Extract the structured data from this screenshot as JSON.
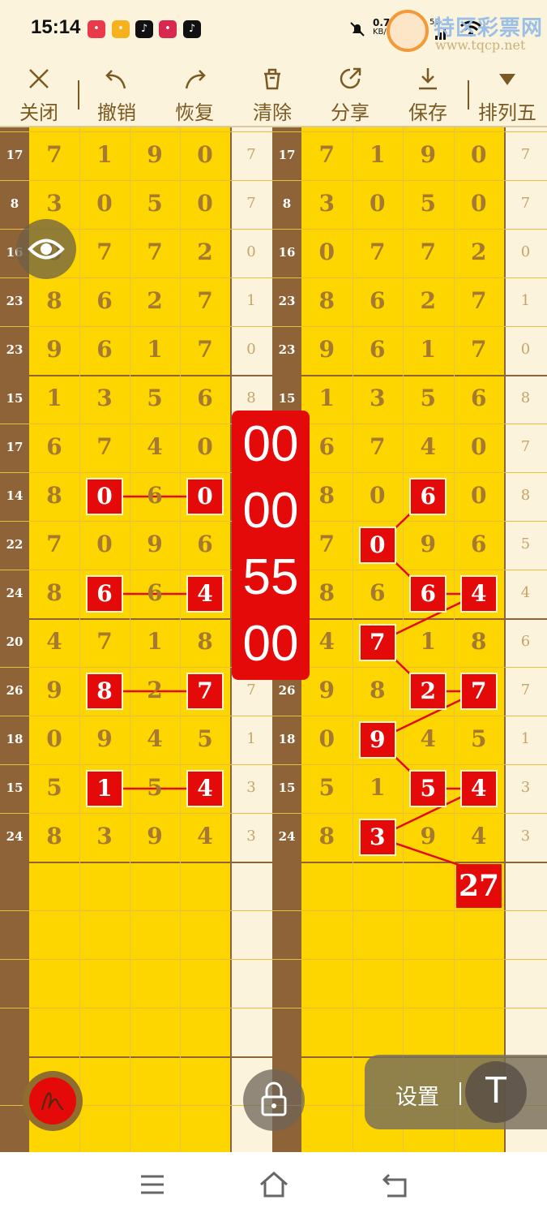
{
  "status": {
    "time": "15:14",
    "net_speed": "0.70 KB/s",
    "net_top": "0.70",
    "net_unit": "KB/s",
    "sig1": "5G",
    "sig2": "5G",
    "apps": [
      {
        "icon": "app-icon-1",
        "color": "#e83a4b"
      },
      {
        "icon": "app-icon-2",
        "color": "#f5b21c"
      },
      {
        "icon": "tiktok-icon",
        "color": "#111111"
      },
      {
        "icon": "app-icon-3",
        "color": "#d8284f"
      },
      {
        "icon": "tiktok-icon",
        "color": "#111111"
      }
    ]
  },
  "watermark": {
    "title": "特区彩票网",
    "url": "www.tqcp.net"
  },
  "toolbar": {
    "close": "关闭",
    "undo": "撤销",
    "redo": "恢复",
    "clear": "清除",
    "share": "分享",
    "save": "保存",
    "mode": "排列五"
  },
  "grid": {
    "rows": [
      {
        "left_num": "17",
        "digits": [
          "7",
          "1",
          "9",
          "0"
        ],
        "span": "7"
      },
      {
        "left_num": "8",
        "digits": [
          "3",
          "0",
          "5",
          "0"
        ],
        "span": "7"
      },
      {
        "left_num": "16",
        "digits": [
          "0",
          "7",
          "7",
          "2"
        ],
        "span": "0"
      },
      {
        "left_num": "23",
        "digits": [
          "8",
          "6",
          "2",
          "7"
        ],
        "span": "1"
      },
      {
        "left_num": "23",
        "digits": [
          "9",
          "6",
          "1",
          "7"
        ],
        "span": "0"
      },
      {
        "left_num": "15",
        "digits": [
          "1",
          "3",
          "5",
          "6"
        ],
        "span": "8"
      },
      {
        "left_num": "17",
        "digits": [
          "6",
          "7",
          "4",
          "0"
        ],
        "span": "7"
      },
      {
        "left_num": "14",
        "digits": [
          "8",
          "0",
          "6",
          "0"
        ],
        "span": "8"
      },
      {
        "left_num": "22",
        "digits": [
          "7",
          "0",
          "9",
          "6"
        ],
        "span": "5"
      },
      {
        "left_num": "24",
        "digits": [
          "8",
          "6",
          "6",
          "4"
        ],
        "span": "4"
      },
      {
        "left_num": "20",
        "digits": [
          "4",
          "7",
          "1",
          "8"
        ],
        "span": "6"
      },
      {
        "left_num": "26",
        "digits": [
          "9",
          "8",
          "2",
          "7"
        ],
        "span": "7"
      },
      {
        "left_num": "18",
        "digits": [
          "0",
          "9",
          "4",
          "5"
        ],
        "span": "1"
      },
      {
        "left_num": "15",
        "digits": [
          "5",
          "1",
          "5",
          "4"
        ],
        "span": "3"
      },
      {
        "left_num": "24",
        "digits": [
          "8",
          "3",
          "9",
          "4"
        ],
        "span": "3"
      }
    ],
    "left_marks": [
      {
        "row": 7,
        "col": 1,
        "value": "0"
      },
      {
        "row": 7,
        "col": 3,
        "value": "0"
      },
      {
        "row": 9,
        "col": 1,
        "value": "6"
      },
      {
        "row": 9,
        "col": 3,
        "value": "4"
      },
      {
        "row": 11,
        "col": 1,
        "value": "8"
      },
      {
        "row": 11,
        "col": 3,
        "value": "7"
      },
      {
        "row": 13,
        "col": 1,
        "value": "1"
      },
      {
        "row": 13,
        "col": 3,
        "value": "4"
      }
    ],
    "right_marks": [
      {
        "row": 7,
        "col": 2,
        "value": "6"
      },
      {
        "row": 8,
        "col": 1,
        "value": "0"
      },
      {
        "row": 9,
        "col": 2,
        "value": "6"
      },
      {
        "row": 9,
        "col": 3,
        "value": "4"
      },
      {
        "row": 10,
        "col": 1,
        "value": "7"
      },
      {
        "row": 11,
        "col": 2,
        "value": "2"
      },
      {
        "row": 11,
        "col": 3,
        "value": "7"
      },
      {
        "row": 12,
        "col": 1,
        "value": "9"
      },
      {
        "row": 13,
        "col": 2,
        "value": "5"
      },
      {
        "row": 13,
        "col": 3,
        "value": "4"
      },
      {
        "row": 14,
        "col": 1,
        "value": "3"
      }
    ],
    "total": "27",
    "line_color": "#e40a0a"
  },
  "counter": [
    "00",
    "00",
    "55",
    "00"
  ],
  "controls": {
    "settings": "设置",
    "text_tool": "T"
  },
  "colors": {
    "gold": "#fdd600",
    "brown": "#8f6338",
    "cream": "#fbf3dc",
    "red": "#e40a0a",
    "digit": "#a5792f"
  }
}
